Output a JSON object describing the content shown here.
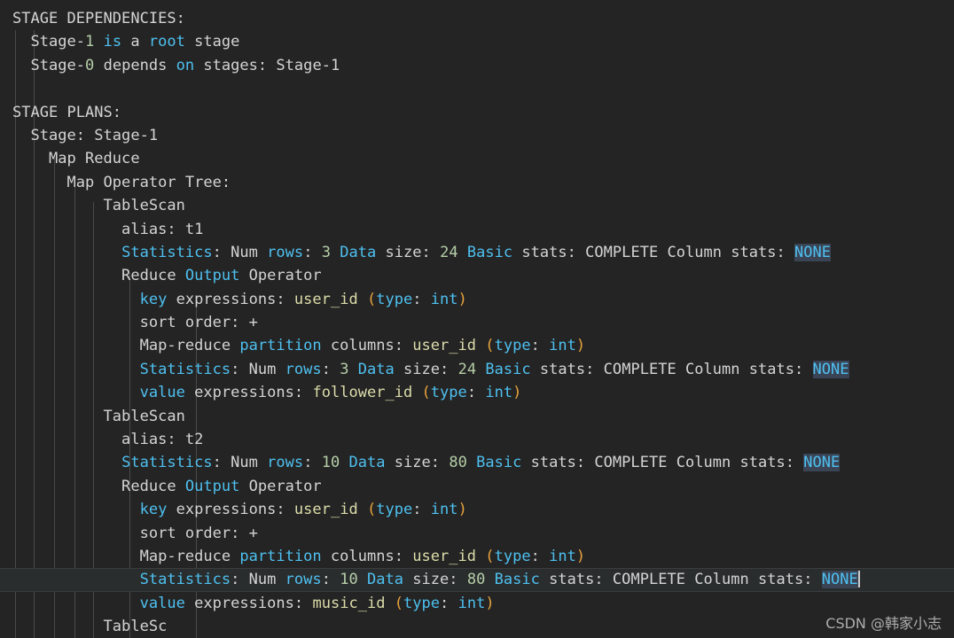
{
  "editor": {
    "background": "#242424",
    "foreground": "#d4d4d4",
    "active_line_background": "#2a2d2e",
    "selection_background": "#3a4455",
    "guide_color": "#4a4a4a",
    "colors": {
      "keyword": "#4ec0f0",
      "number": "#b5cea8",
      "identifier": "#dcdcaa",
      "paren": "#e8a33d",
      "plain": "#d4d4d4"
    },
    "guide_positions": [
      17,
      38,
      61,
      84,
      105,
      146,
      221
    ]
  },
  "watermark": {
    "text": "CSDN @韩家小志"
  },
  "lines": [
    {
      "id": 1,
      "active": false,
      "tokens": [
        {
          "t": "STAGE DEPENDENCIES:",
          "c": "plain"
        }
      ]
    },
    {
      "id": 2,
      "active": false,
      "tokens": [
        {
          "t": "  Stage-",
          "c": "plain"
        },
        {
          "t": "1",
          "c": "num"
        },
        {
          "t": " ",
          "c": "plain"
        },
        {
          "t": "is",
          "c": "kw"
        },
        {
          "t": " a ",
          "c": "plain"
        },
        {
          "t": "root",
          "c": "kw"
        },
        {
          "t": " stage",
          "c": "plain"
        }
      ]
    },
    {
      "id": 3,
      "active": false,
      "tokens": [
        {
          "t": "  Stage-",
          "c": "plain"
        },
        {
          "t": "0",
          "c": "num"
        },
        {
          "t": " depends ",
          "c": "plain"
        },
        {
          "t": "on",
          "c": "kw"
        },
        {
          "t": " stages: Stage-1",
          "c": "plain"
        }
      ]
    },
    {
      "id": 4,
      "active": false,
      "tokens": [
        {
          "t": "",
          "c": "plain"
        }
      ]
    },
    {
      "id": 5,
      "active": false,
      "tokens": [
        {
          "t": "STAGE PLANS:",
          "c": "plain"
        }
      ]
    },
    {
      "id": 6,
      "active": false,
      "tokens": [
        {
          "t": "  Stage: Stage-1",
          "c": "plain"
        }
      ]
    },
    {
      "id": 7,
      "active": false,
      "tokens": [
        {
          "t": "    Map Reduce",
          "c": "plain"
        }
      ]
    },
    {
      "id": 8,
      "active": false,
      "tokens": [
        {
          "t": "      Map Operator Tree:",
          "c": "plain"
        }
      ]
    },
    {
      "id": 9,
      "active": false,
      "tokens": [
        {
          "t": "          TableScan",
          "c": "plain"
        }
      ]
    },
    {
      "id": 10,
      "active": false,
      "tokens": [
        {
          "t": "            alias: t1",
          "c": "plain"
        }
      ]
    },
    {
      "id": 11,
      "active": false,
      "tokens": [
        {
          "t": "            ",
          "c": "plain"
        },
        {
          "t": "Statistics",
          "c": "kw"
        },
        {
          "t": ": Num ",
          "c": "plain"
        },
        {
          "t": "rows",
          "c": "kw"
        },
        {
          "t": ": ",
          "c": "plain"
        },
        {
          "t": "3",
          "c": "num"
        },
        {
          "t": " ",
          "c": "plain"
        },
        {
          "t": "Data",
          "c": "kw"
        },
        {
          "t": " size: ",
          "c": "plain"
        },
        {
          "t": "24",
          "c": "num"
        },
        {
          "t": " ",
          "c": "plain"
        },
        {
          "t": "Basic",
          "c": "kw"
        },
        {
          "t": " stats: COMPLETE Column stats: ",
          "c": "plain"
        },
        {
          "t": "NONE",
          "c": "sel"
        }
      ]
    },
    {
      "id": 12,
      "active": false,
      "tokens": [
        {
          "t": "            Reduce ",
          "c": "plain"
        },
        {
          "t": "Output",
          "c": "kw"
        },
        {
          "t": " Operator",
          "c": "plain"
        }
      ]
    },
    {
      "id": 13,
      "active": false,
      "tokens": [
        {
          "t": "              ",
          "c": "plain"
        },
        {
          "t": "key",
          "c": "kw"
        },
        {
          "t": " expressions: ",
          "c": "plain"
        },
        {
          "t": "user_id",
          "c": "ident"
        },
        {
          "t": " ",
          "c": "plain"
        },
        {
          "t": "(",
          "c": "paren"
        },
        {
          "t": "type",
          "c": "kw"
        },
        {
          "t": ": ",
          "c": "plain"
        },
        {
          "t": "int",
          "c": "kw"
        },
        {
          "t": ")",
          "c": "paren"
        }
      ]
    },
    {
      "id": 14,
      "active": false,
      "tokens": [
        {
          "t": "              sort order: +",
          "c": "plain"
        }
      ]
    },
    {
      "id": 15,
      "active": false,
      "tokens": [
        {
          "t": "              Map-reduce ",
          "c": "plain"
        },
        {
          "t": "partition",
          "c": "kw"
        },
        {
          "t": " columns: ",
          "c": "plain"
        },
        {
          "t": "user_id",
          "c": "ident"
        },
        {
          "t": " ",
          "c": "plain"
        },
        {
          "t": "(",
          "c": "paren"
        },
        {
          "t": "type",
          "c": "kw"
        },
        {
          "t": ": ",
          "c": "plain"
        },
        {
          "t": "int",
          "c": "kw"
        },
        {
          "t": ")",
          "c": "paren"
        }
      ]
    },
    {
      "id": 16,
      "active": false,
      "tokens": [
        {
          "t": "              ",
          "c": "plain"
        },
        {
          "t": "Statistics",
          "c": "kw"
        },
        {
          "t": ": Num ",
          "c": "plain"
        },
        {
          "t": "rows",
          "c": "kw"
        },
        {
          "t": ": ",
          "c": "plain"
        },
        {
          "t": "3",
          "c": "num"
        },
        {
          "t": " ",
          "c": "plain"
        },
        {
          "t": "Data",
          "c": "kw"
        },
        {
          "t": " size: ",
          "c": "plain"
        },
        {
          "t": "24",
          "c": "num"
        },
        {
          "t": " ",
          "c": "plain"
        },
        {
          "t": "Basic",
          "c": "kw"
        },
        {
          "t": " stats: COMPLETE Column stats: ",
          "c": "plain"
        },
        {
          "t": "NONE",
          "c": "sel"
        }
      ]
    },
    {
      "id": 17,
      "active": false,
      "tokens": [
        {
          "t": "              ",
          "c": "plain"
        },
        {
          "t": "value",
          "c": "kw"
        },
        {
          "t": " expressions: ",
          "c": "plain"
        },
        {
          "t": "follower_id",
          "c": "ident"
        },
        {
          "t": " ",
          "c": "plain"
        },
        {
          "t": "(",
          "c": "paren"
        },
        {
          "t": "type",
          "c": "kw"
        },
        {
          "t": ": ",
          "c": "plain"
        },
        {
          "t": "int",
          "c": "kw"
        },
        {
          "t": ")",
          "c": "paren"
        }
      ]
    },
    {
      "id": 18,
      "active": false,
      "tokens": [
        {
          "t": "          TableScan",
          "c": "plain"
        }
      ]
    },
    {
      "id": 19,
      "active": false,
      "tokens": [
        {
          "t": "            alias: t2",
          "c": "plain"
        }
      ]
    },
    {
      "id": 20,
      "active": false,
      "tokens": [
        {
          "t": "            ",
          "c": "plain"
        },
        {
          "t": "Statistics",
          "c": "kw"
        },
        {
          "t": ": Num ",
          "c": "plain"
        },
        {
          "t": "rows",
          "c": "kw"
        },
        {
          "t": ": ",
          "c": "plain"
        },
        {
          "t": "10",
          "c": "num"
        },
        {
          "t": " ",
          "c": "plain"
        },
        {
          "t": "Data",
          "c": "kw"
        },
        {
          "t": " size: ",
          "c": "plain"
        },
        {
          "t": "80",
          "c": "num"
        },
        {
          "t": " ",
          "c": "plain"
        },
        {
          "t": "Basic",
          "c": "kw"
        },
        {
          "t": " stats: COMPLETE Column stats: ",
          "c": "plain"
        },
        {
          "t": "NONE",
          "c": "sel"
        }
      ]
    },
    {
      "id": 21,
      "active": false,
      "tokens": [
        {
          "t": "            Reduce ",
          "c": "plain"
        },
        {
          "t": "Output",
          "c": "kw"
        },
        {
          "t": " Operator",
          "c": "plain"
        }
      ]
    },
    {
      "id": 22,
      "active": false,
      "tokens": [
        {
          "t": "              ",
          "c": "plain"
        },
        {
          "t": "key",
          "c": "kw"
        },
        {
          "t": " expressions: ",
          "c": "plain"
        },
        {
          "t": "user_id",
          "c": "ident"
        },
        {
          "t": " ",
          "c": "plain"
        },
        {
          "t": "(",
          "c": "paren"
        },
        {
          "t": "type",
          "c": "kw"
        },
        {
          "t": ": ",
          "c": "plain"
        },
        {
          "t": "int",
          "c": "kw"
        },
        {
          "t": ")",
          "c": "paren"
        }
      ]
    },
    {
      "id": 23,
      "active": false,
      "tokens": [
        {
          "t": "              sort order: +",
          "c": "plain"
        }
      ]
    },
    {
      "id": 24,
      "active": false,
      "tokens": [
        {
          "t": "              Map-reduce ",
          "c": "plain"
        },
        {
          "t": "partition",
          "c": "kw"
        },
        {
          "t": " columns: ",
          "c": "plain"
        },
        {
          "t": "user_id",
          "c": "ident"
        },
        {
          "t": " ",
          "c": "plain"
        },
        {
          "t": "(",
          "c": "paren"
        },
        {
          "t": "type",
          "c": "kw"
        },
        {
          "t": ": ",
          "c": "plain"
        },
        {
          "t": "int",
          "c": "kw"
        },
        {
          "t": ")",
          "c": "paren"
        }
      ]
    },
    {
      "id": 25,
      "active": true,
      "caret": true,
      "tokens": [
        {
          "t": "              ",
          "c": "plain"
        },
        {
          "t": "Statistics",
          "c": "kw"
        },
        {
          "t": ": Num ",
          "c": "plain"
        },
        {
          "t": "rows",
          "c": "kw"
        },
        {
          "t": ": ",
          "c": "plain"
        },
        {
          "t": "10",
          "c": "num"
        },
        {
          "t": " ",
          "c": "plain"
        },
        {
          "t": "Data",
          "c": "kw"
        },
        {
          "t": " size: ",
          "c": "plain"
        },
        {
          "t": "80",
          "c": "num"
        },
        {
          "t": " ",
          "c": "plain"
        },
        {
          "t": "Basic",
          "c": "kw"
        },
        {
          "t": " stats: COMPLETE Column stats: ",
          "c": "plain"
        },
        {
          "t": "NONE",
          "c": "sel"
        }
      ]
    },
    {
      "id": 26,
      "active": false,
      "tokens": [
        {
          "t": "              ",
          "c": "plain"
        },
        {
          "t": "value",
          "c": "kw"
        },
        {
          "t": " expressions: ",
          "c": "plain"
        },
        {
          "t": "music_id",
          "c": "ident"
        },
        {
          "t": " ",
          "c": "plain"
        },
        {
          "t": "(",
          "c": "paren"
        },
        {
          "t": "type",
          "c": "kw"
        },
        {
          "t": ": ",
          "c": "plain"
        },
        {
          "t": "int",
          "c": "kw"
        },
        {
          "t": ")",
          "c": "paren"
        }
      ]
    },
    {
      "id": 27,
      "active": false,
      "tokens": [
        {
          "t": "          TableSc",
          "c": "plain"
        }
      ]
    }
  ]
}
